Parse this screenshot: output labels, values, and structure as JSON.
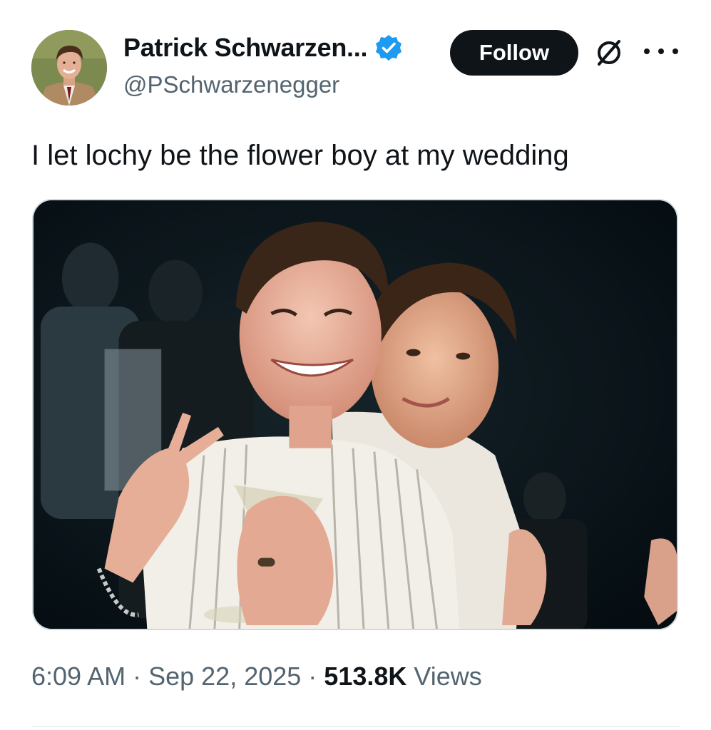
{
  "author": {
    "display_name": "Patrick Schwarzen...",
    "handle": "@PSchwarzenegger",
    "verified": true,
    "avatar_icon": "avatar-photo"
  },
  "actions": {
    "follow_label": "Follow",
    "grok_icon": "grok-icon",
    "more_icon": "more-options-icon"
  },
  "tweet": {
    "text": "I let lochy be the flower boy at my wedding",
    "media_alt": "photo"
  },
  "meta": {
    "time": "6:09 AM",
    "separator": "·",
    "date": "Sep 22, 2025",
    "views_count": "513.8K",
    "views_label": "Views"
  },
  "colors": {
    "text_primary": "#0f1419",
    "text_secondary": "#536471",
    "verified_blue": "#1d9bf0",
    "follow_bg": "#0f1419"
  }
}
